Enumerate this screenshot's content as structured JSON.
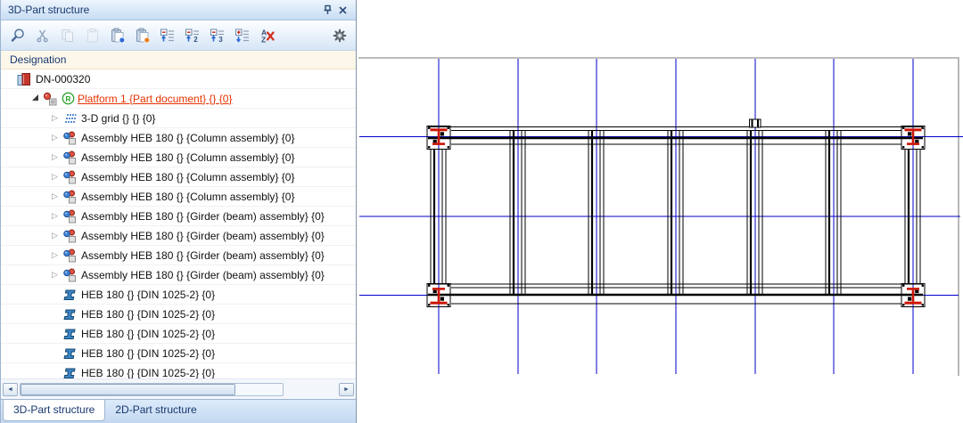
{
  "panel": {
    "title": "3D-Part structure",
    "titlebar_icons": [
      "pin-icon",
      "close-icon"
    ],
    "toolbar": {
      "icons": [
        "find-part",
        "cut",
        "copy",
        "paste",
        "insert-from-clipboard",
        "insert-from-clipboard-active",
        "collapse-all",
        "collapse-to-level-2",
        "collapse-to-level-3",
        "expand-all",
        "sort-off",
        "settings"
      ],
      "level2_label": "2",
      "level3_label": "3",
      "sort_a": "A",
      "sort_z": "Z"
    },
    "column_header": "Designation",
    "tree": {
      "rows": [
        {
          "label": "DN-000320",
          "level": 1,
          "icon": "document",
          "twisty": "none"
        },
        {
          "label": "Platform 1 {Part document} {} {0}",
          "level": 2,
          "icon": "platform-assembly",
          "twisty": "expanded",
          "badge": "R",
          "highlight": "active-red"
        },
        {
          "label": "3-D grid {} {} {0}",
          "level": 3,
          "icon": "grid-3d",
          "twisty": "collapsed"
        },
        {
          "label": "Assembly HEB 180 {} {Column assembly} {0}",
          "level": 3,
          "icon": "assembly",
          "twisty": "collapsed"
        },
        {
          "label": "Assembly HEB 180 {} {Column assembly} {0}",
          "level": 3,
          "icon": "assembly",
          "twisty": "collapsed"
        },
        {
          "label": "Assembly HEB 180 {} {Column assembly} {0}",
          "level": 3,
          "icon": "assembly",
          "twisty": "collapsed"
        },
        {
          "label": "Assembly HEB 180 {} {Column assembly} {0}",
          "level": 3,
          "icon": "assembly",
          "twisty": "collapsed"
        },
        {
          "label": "Assembly HEB 180 {} {Girder (beam) assembly} {0}",
          "level": 3,
          "icon": "assembly",
          "twisty": "collapsed"
        },
        {
          "label": "Assembly HEB 180 {} {Girder (beam) assembly} {0}",
          "level": 3,
          "icon": "assembly",
          "twisty": "collapsed"
        },
        {
          "label": "Assembly HEB 180 {} {Girder (beam) assembly} {0}",
          "level": 3,
          "icon": "assembly",
          "twisty": "collapsed"
        },
        {
          "label": "Assembly HEB 180 {} {Girder (beam) assembly} {0}",
          "level": 3,
          "icon": "assembly",
          "twisty": "collapsed"
        },
        {
          "label": "HEB 180 {} {DIN 1025-2} {0}",
          "level": 3,
          "icon": "beam-profile",
          "twisty": "none"
        },
        {
          "label": "HEB 180 {} {DIN 1025-2} {0}",
          "level": 3,
          "icon": "beam-profile",
          "twisty": "none"
        },
        {
          "label": "HEB 180 {} {DIN 1025-2} {0}",
          "level": 3,
          "icon": "beam-profile",
          "twisty": "none"
        },
        {
          "label": "HEB 180 {} {DIN 1025-2} {0}",
          "level": 3,
          "icon": "beam-profile",
          "twisty": "none"
        },
        {
          "label": "HEB 180 {} {DIN 1025-2} {0}",
          "level": 3,
          "icon": "beam-profile",
          "twisty": "none"
        }
      ]
    },
    "tabs": [
      {
        "label": "3D-Part structure",
        "active": true
      },
      {
        "label": "2D-Part structure",
        "active": false
      }
    ]
  },
  "drawing": {
    "type": "steel-platform-plan-view",
    "grid": {
      "vertical_lines": 7,
      "horizontal_lines": 3,
      "color": "#0000cd"
    },
    "corner_columns": 4,
    "column_profile_color": "#cc1505",
    "beam_color": "#000000",
    "sheet_frame_color": "#a7a7a7",
    "background": "#ffffff"
  }
}
